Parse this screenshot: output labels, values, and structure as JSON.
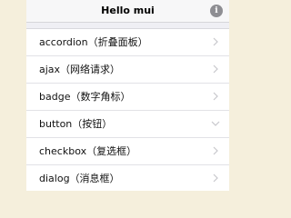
{
  "navbar": {
    "title": "Hello mui",
    "info_icon": "info-icon",
    "info_glyph": "i"
  },
  "list": {
    "items": [
      {
        "label": "accordion（折叠面板）",
        "chevron": "chevron-right-icon"
      },
      {
        "label": "ajax（网络请求）",
        "chevron": "chevron-right-icon"
      },
      {
        "label": "badge（数字角标）",
        "chevron": "chevron-right-icon"
      },
      {
        "label": "button（按钮）",
        "chevron": "chevron-down-icon"
      },
      {
        "label": "checkbox（复选框）",
        "chevron": "chevron-right-icon"
      },
      {
        "label": "dialog（消息框）",
        "chevron": "chevron-right-icon"
      }
    ]
  },
  "colors": {
    "page_background": "#f5efdc",
    "navbar_background": "#f7f7f8",
    "info_icon": "#8e8e93",
    "chevron": "#c7c7cc"
  }
}
